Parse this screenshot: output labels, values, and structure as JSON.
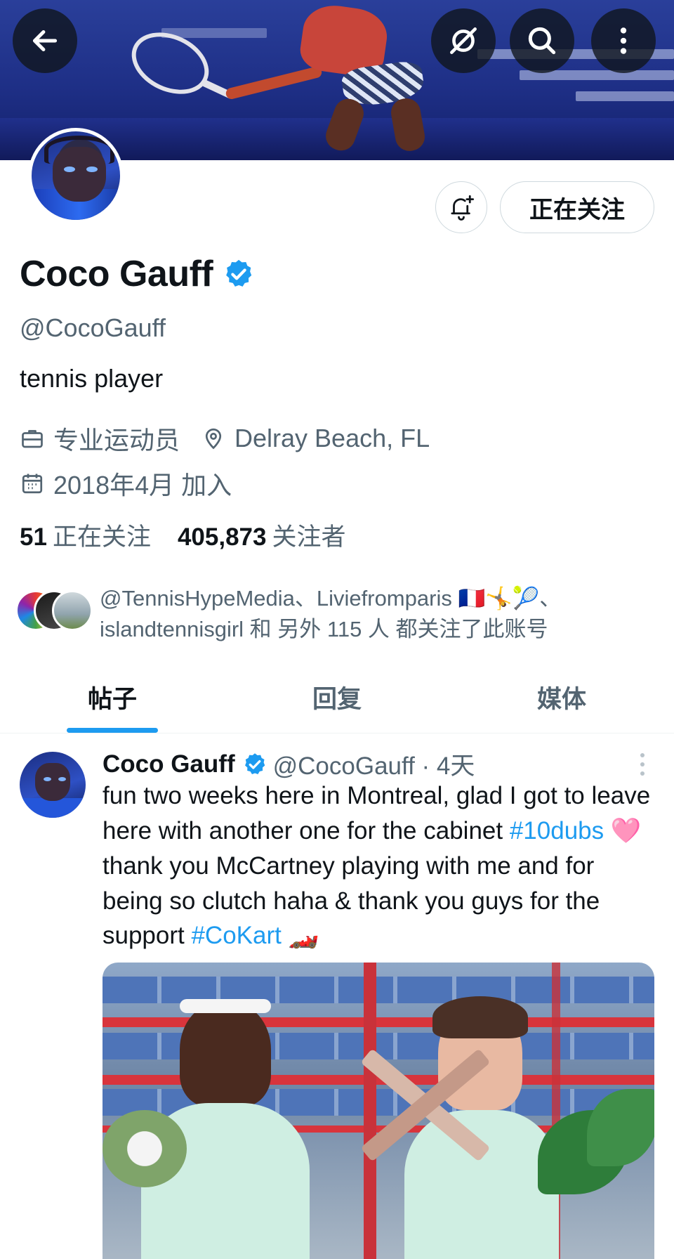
{
  "header": {
    "back_icon": "arrow-left-icon",
    "actions": [
      "translate-slash-icon",
      "search-icon",
      "more-vertical-icon"
    ]
  },
  "profile": {
    "name": "Coco Gauff",
    "verified_icon": "verified-badge-icon",
    "handle": "@CocoGauff",
    "bio": "tennis player",
    "profession": "专业运动员",
    "location": "Delray Beach, FL",
    "joined": "2018年4月 加入",
    "following_count": "51",
    "following_label": "正在关注",
    "followers_count": "405,873",
    "followers_label": "关注者",
    "follow_button_label": "正在关注",
    "followed_by_line1": "@TennisHypeMedia、Liviefromparis 🇫🇷🤸🎾、",
    "followed_by_line2": "islandtennisgirl 和 另外 115 人 都关注了此账号"
  },
  "tabs": [
    {
      "label": "帖子",
      "active": true
    },
    {
      "label": "回复",
      "active": false
    },
    {
      "label": "媒体",
      "active": false
    }
  ],
  "post": {
    "author": "Coco Gauff",
    "handle_time": "@CocoGauff · 4天",
    "text_1": "fun two weeks here in Montreal, glad I got to leave here with another one for the cabinet ",
    "hashtag_1": "#10dubs",
    "emoji_1": "🩷",
    "text_2": " thank you McCartney playing with me and for being so clutch haha & thank you guys for the support ",
    "hashtag_2": "#CoKart",
    "emoji_2": "🏎️"
  },
  "colors": {
    "accent": "#1d9bf0",
    "text": "#0f1419",
    "secondary": "#536471",
    "border": "#cfd9de"
  }
}
